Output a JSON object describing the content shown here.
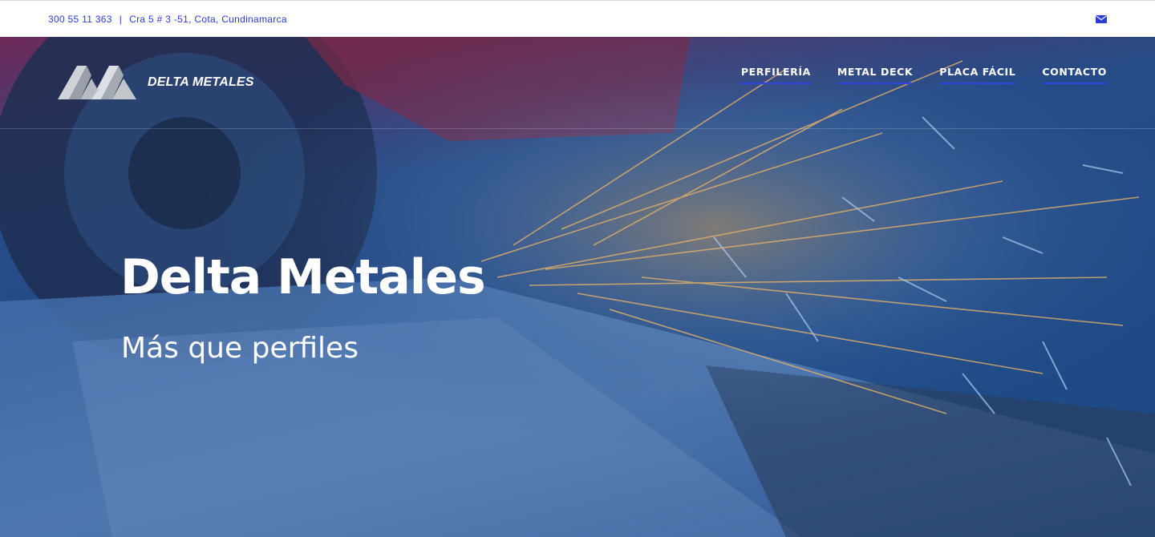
{
  "topbar": {
    "phone": "300 55 11 363",
    "separator": "|",
    "address": "Cra 5 # 3 -51, Cota, Cundinamarca",
    "mail_icon": "envelope-icon"
  },
  "header": {
    "logo_text": "DELTA METALES",
    "nav": [
      {
        "label": "PERFILERÍA"
      },
      {
        "label": "METAL DECK"
      },
      {
        "label": "PLACA FÁCIL"
      },
      {
        "label": "CONTACTO"
      }
    ]
  },
  "hero": {
    "title": "Delta Metales",
    "subtitle": "Más que perfiles"
  },
  "colors": {
    "accent": "#2f47e0",
    "link": "#2b3bd6",
    "hero_overlay_top": "#7a2a55",
    "hero_overlay": "#163e78"
  }
}
